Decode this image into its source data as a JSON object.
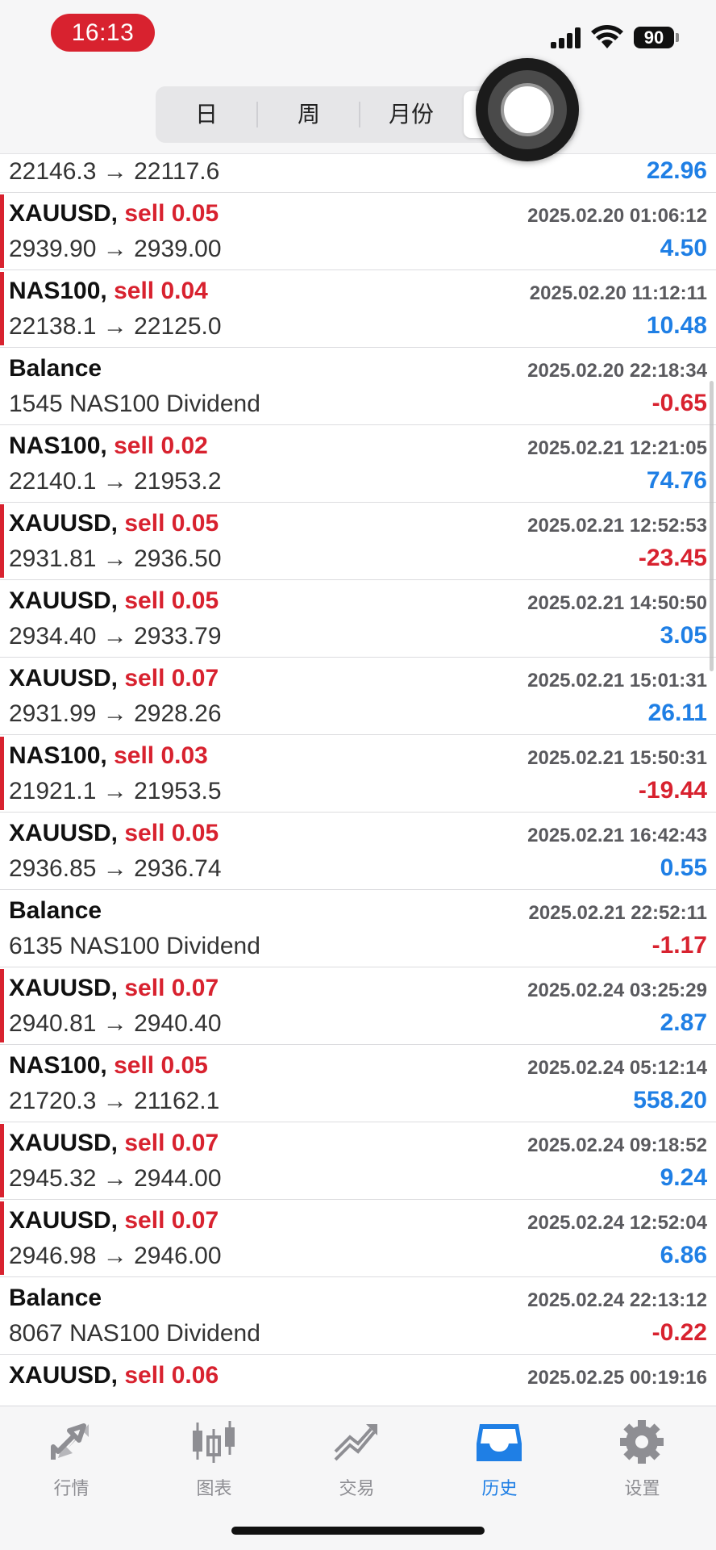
{
  "status": {
    "time": "16:13",
    "battery": "90"
  },
  "header": {
    "segments": [
      "日",
      "周",
      "月份",
      ""
    ],
    "selected_index": 3
  },
  "colors": {
    "profit": "#1f7fe5",
    "loss": "#d8222f",
    "accent": "#1f7fe5"
  },
  "history": {
    "top_row": {
      "prices": "22146.3 → 22117.6",
      "profit": "22.96",
      "sign": "pos"
    },
    "rows": [
      {
        "symbol": "XAUUSD,",
        "side": "sell 0.05",
        "datetime": "2025.02.20 01:06:12",
        "detail": "2939.90 → 2939.00",
        "profit": "4.50",
        "sign": "pos",
        "bar": true
      },
      {
        "symbol": "NAS100,",
        "side": "sell 0.04",
        "datetime": "2025.02.20 11:12:11",
        "detail": "22138.1 → 22125.0",
        "profit": "10.48",
        "sign": "pos",
        "bar": true
      },
      {
        "symbol": "Balance",
        "side": "",
        "datetime": "2025.02.20 22:18:34",
        "detail": "1545 NAS100 Dividend",
        "profit": "-0.65",
        "sign": "neg",
        "bar": false
      },
      {
        "symbol": "NAS100,",
        "side": "sell 0.02",
        "datetime": "2025.02.21 12:21:05",
        "detail": "22140.1 → 21953.2",
        "profit": "74.76",
        "sign": "pos",
        "bar": false
      },
      {
        "symbol": "XAUUSD,",
        "side": "sell 0.05",
        "datetime": "2025.02.21 12:52:53",
        "detail": "2931.81 → 2936.50",
        "profit": "-23.45",
        "sign": "neg",
        "bar": true
      },
      {
        "symbol": "XAUUSD,",
        "side": "sell 0.05",
        "datetime": "2025.02.21 14:50:50",
        "detail": "2934.40 → 2933.79",
        "profit": "3.05",
        "sign": "pos",
        "bar": false
      },
      {
        "symbol": "XAUUSD,",
        "side": "sell 0.07",
        "datetime": "2025.02.21 15:01:31",
        "detail": "2931.99 → 2928.26",
        "profit": "26.11",
        "sign": "pos",
        "bar": false
      },
      {
        "symbol": "NAS100,",
        "side": "sell 0.03",
        "datetime": "2025.02.21 15:50:31",
        "detail": "21921.1 → 21953.5",
        "profit": "-19.44",
        "sign": "neg",
        "bar": true
      },
      {
        "symbol": "XAUUSD,",
        "side": "sell 0.05",
        "datetime": "2025.02.21 16:42:43",
        "detail": "2936.85 → 2936.74",
        "profit": "0.55",
        "sign": "pos",
        "bar": false
      },
      {
        "symbol": "Balance",
        "side": "",
        "datetime": "2025.02.21 22:52:11",
        "detail": "6135 NAS100 Dividend",
        "profit": "-1.17",
        "sign": "neg",
        "bar": false
      },
      {
        "symbol": "XAUUSD,",
        "side": "sell 0.07",
        "datetime": "2025.02.24 03:25:29",
        "detail": "2940.81 → 2940.40",
        "profit": "2.87",
        "sign": "pos",
        "bar": true
      },
      {
        "symbol": "NAS100,",
        "side": "sell 0.05",
        "datetime": "2025.02.24 05:12:14",
        "detail": "21720.3 → 21162.1",
        "profit": "558.20",
        "sign": "pos",
        "bar": false
      },
      {
        "symbol": "XAUUSD,",
        "side": "sell 0.07",
        "datetime": "2025.02.24 09:18:52",
        "detail": "2945.32 → 2944.00",
        "profit": "9.24",
        "sign": "pos",
        "bar": true
      },
      {
        "symbol": "XAUUSD,",
        "side": "sell 0.07",
        "datetime": "2025.02.24 12:52:04",
        "detail": "2946.98 → 2946.00",
        "profit": "6.86",
        "sign": "pos",
        "bar": true
      },
      {
        "symbol": "Balance",
        "side": "",
        "datetime": "2025.02.24 22:13:12",
        "detail": "8067 NAS100 Dividend",
        "profit": "-0.22",
        "sign": "neg",
        "bar": false
      },
      {
        "symbol": "XAUUSD,",
        "side": "sell 0.06",
        "datetime": "2025.02.25 00:19:16",
        "detail": "",
        "profit": "",
        "sign": "pos",
        "bar": false
      }
    ]
  },
  "tabbar": {
    "items": [
      {
        "label": "行情",
        "icon": "quotes-arrows-icon"
      },
      {
        "label": "图表",
        "icon": "candlestick-chart-icon"
      },
      {
        "label": "交易",
        "icon": "trade-trend-icon"
      },
      {
        "label": "历史",
        "icon": "history-inbox-icon"
      },
      {
        "label": "设置",
        "icon": "gear-icon"
      }
    ],
    "active_index": 3
  }
}
